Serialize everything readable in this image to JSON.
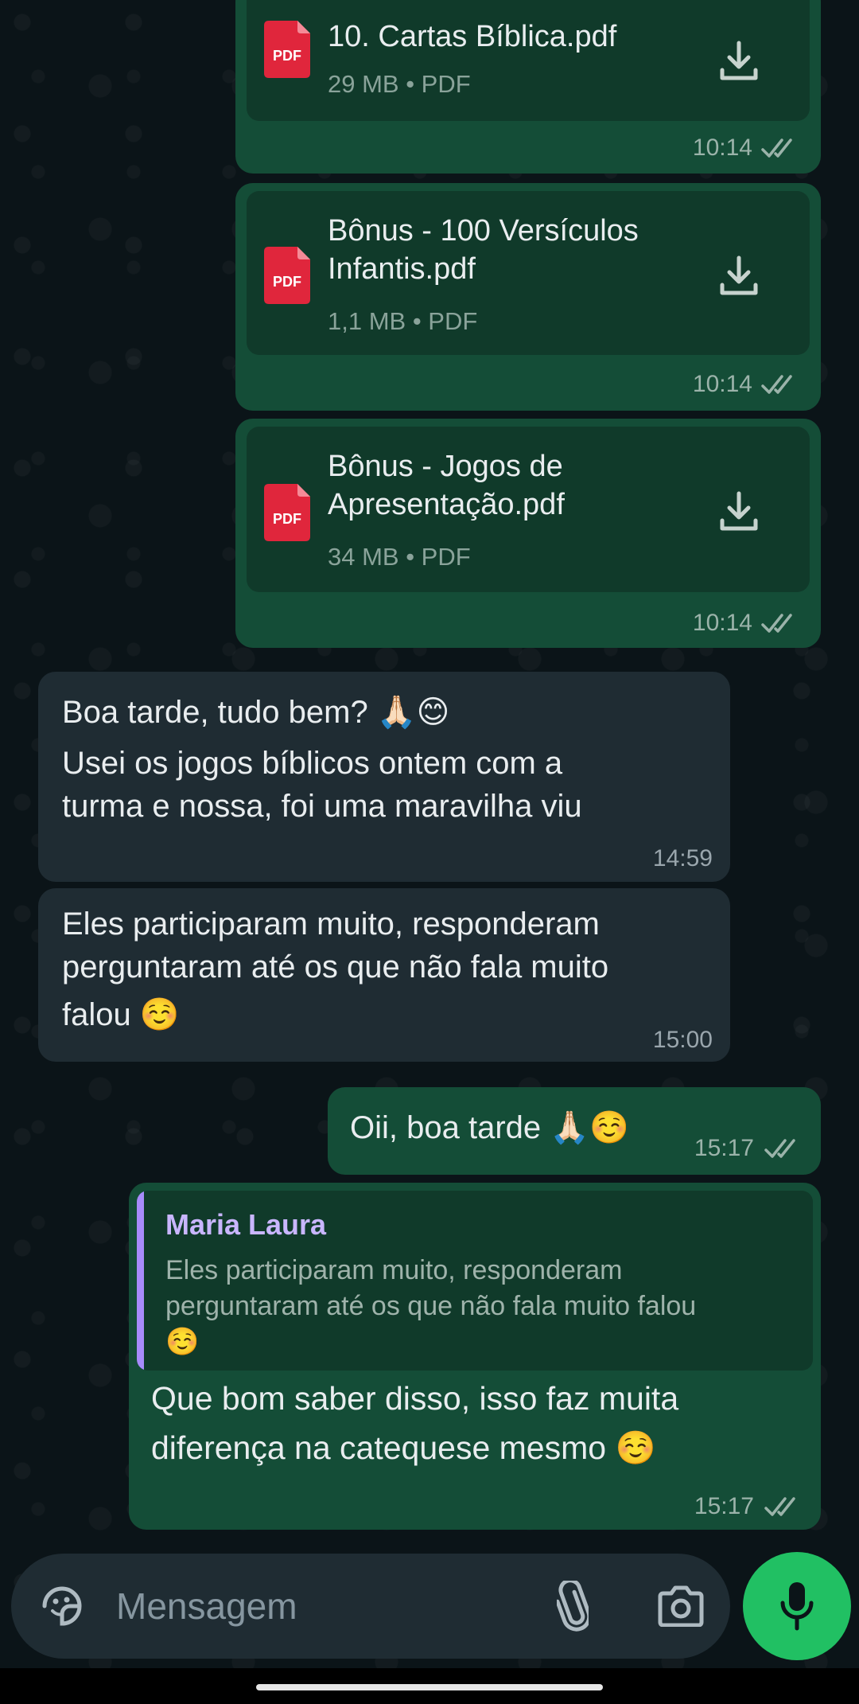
{
  "messages": {
    "file1": {
      "name": "10. Cartas Bíblica.pdf",
      "meta": "29 MB • PDF",
      "time": "10:14",
      "badge": "PDF"
    },
    "file2": {
      "name_line1": "Bônus - 100 Versículos",
      "name_line2": "Infantis.pdf",
      "meta": "1,1 MB • PDF",
      "time": "10:14",
      "badge": "PDF"
    },
    "file3": {
      "name_line1": "Bônus - Jogos de",
      "name_line2": "Apresentação.pdf",
      "meta": "34 MB • PDF",
      "time": "10:14",
      "badge": "PDF"
    },
    "in1": {
      "line1": "Boa tarde, tudo bem? 🙏🏻😊",
      "line2": "Usei os jogos bíblicos ontem com a",
      "line3": "turma e nossa, foi uma maravilha viu",
      "time": "14:59"
    },
    "in2": {
      "line1": "Eles participaram muito, responderam",
      "line2": "perguntaram até os que não fala muito",
      "line3": "falou ☺️",
      "time": "15:00"
    },
    "out1": {
      "text": "Oii, boa tarde 🙏🏻☺️",
      "time": "15:17"
    },
    "out2": {
      "quote_author": "Maria Laura",
      "quote_line1": "Eles participaram muito, responderam",
      "quote_line2": "perguntaram até os que não fala muito falou",
      "quote_line3": "☺️",
      "line1": "Que bom saber disso, isso faz muita",
      "line2": "diferença na catequese mesmo ☺️",
      "time": "15:17"
    }
  },
  "composer": {
    "placeholder": "Mensagem"
  },
  "icons": {
    "pdf": "pdf-file-icon",
    "download": "download-icon",
    "ticks": "double-check-icon",
    "sticker": "sticker-icon",
    "attach": "paperclip-icon",
    "camera": "camera-icon",
    "mic": "microphone-icon"
  },
  "colors": {
    "outgoing_bubble": "#144d37",
    "incoming_bubble": "#1f2c33",
    "read_ticks": "#9bb3aa",
    "pdf_red": "#e0263c",
    "quote_bar": "#a78bfa",
    "mic_button": "#21c063"
  }
}
